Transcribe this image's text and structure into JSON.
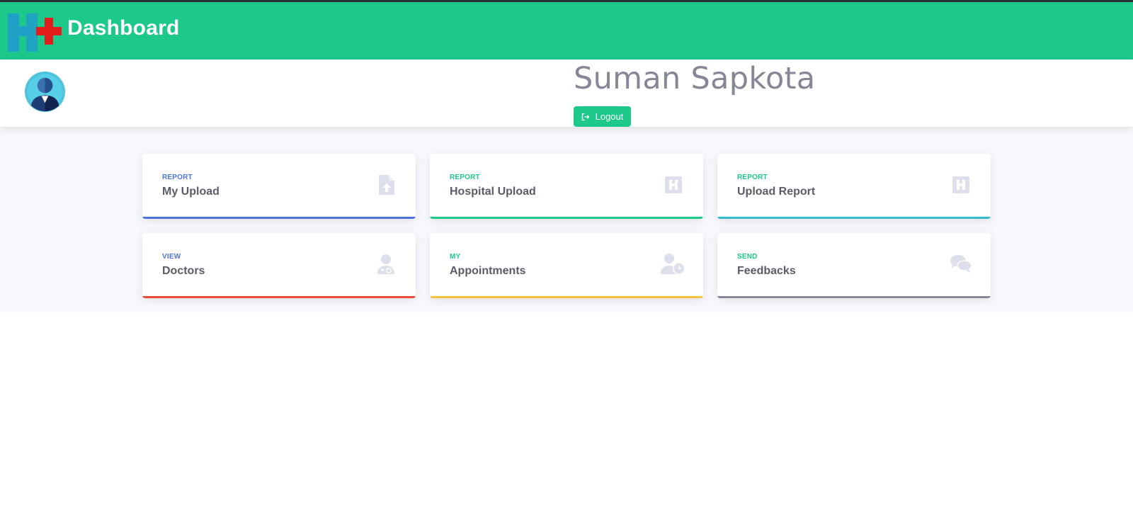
{
  "navbar": {
    "brand": "Dashboard",
    "logo_icon": "hospital-logo-icon",
    "bg_color": "#1cc88a"
  },
  "profile": {
    "name": "Suman Sapkota",
    "logout_label": "Logout",
    "avatar_icon": "user-avatar-icon"
  },
  "cards": [
    {
      "kicker": "REPORT",
      "title": "My Upload",
      "icon": "file-upload-icon",
      "color": "#4e73df"
    },
    {
      "kicker": "REPORT",
      "title": "Hospital Upload",
      "icon": "hospital-icon",
      "color": "#1cc88a"
    },
    {
      "kicker": "REPORT",
      "title": "Upload Report",
      "icon": "hospital-icon",
      "color": "#36b9cc"
    },
    {
      "kicker": "VIEW",
      "title": "Doctors",
      "icon": "doctor-icon",
      "color": "#e74a3b"
    },
    {
      "kicker": "MY",
      "title": "Appointments",
      "icon": "user-clock-icon",
      "color": "#f6c23e"
    },
    {
      "kicker": "SEND",
      "title": "Feedbacks",
      "icon": "comments-icon",
      "color": "#858796"
    }
  ]
}
